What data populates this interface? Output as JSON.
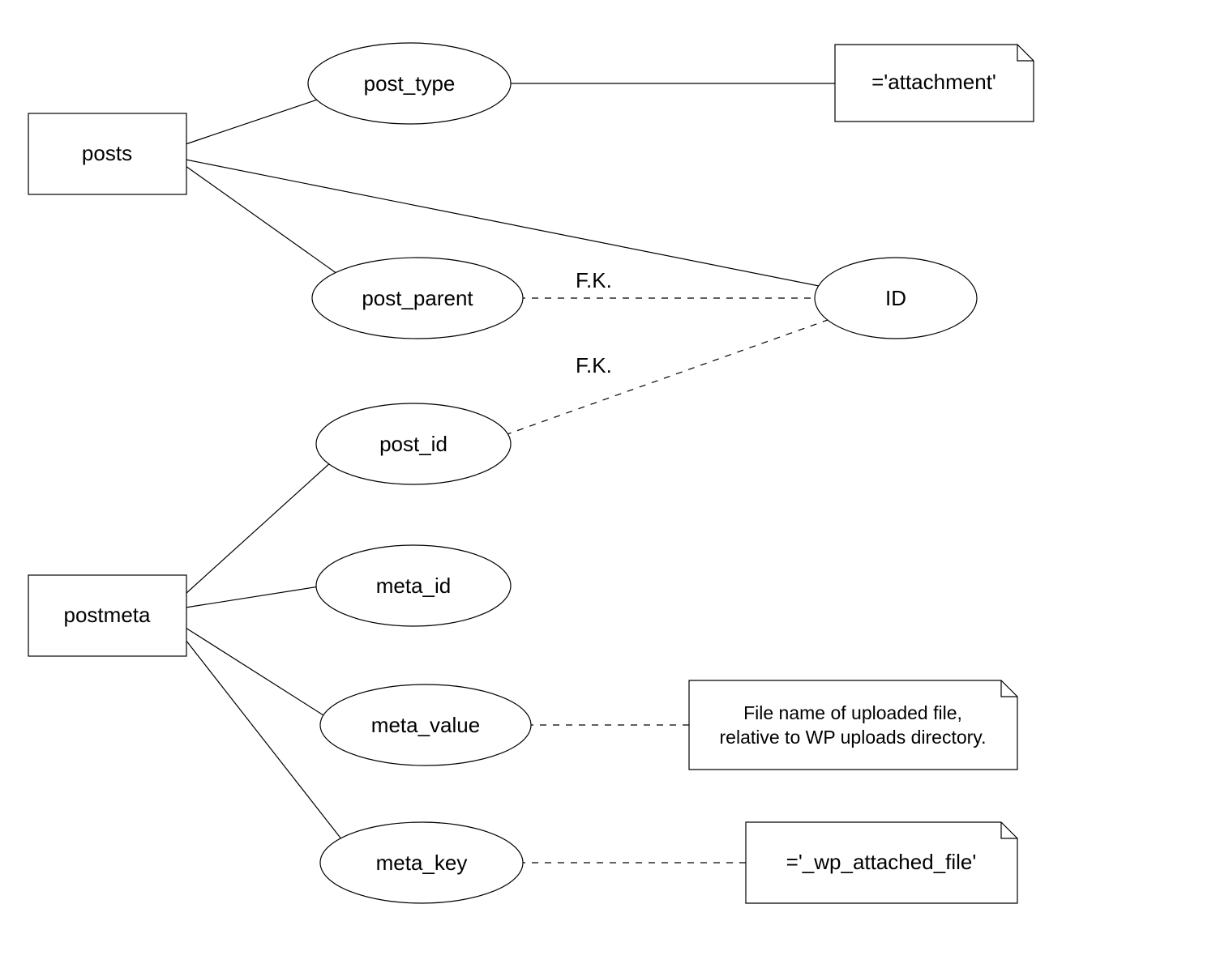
{
  "entities": {
    "posts": "posts",
    "postmeta": "postmeta"
  },
  "attributes": {
    "post_type": "post_type",
    "post_parent": "post_parent",
    "id": "ID",
    "post_id": "post_id",
    "meta_id": "meta_id",
    "meta_value": "meta_value",
    "meta_key": "meta_key"
  },
  "notes": {
    "attachment": "='attachment'",
    "meta_value_note_line1": "File name of uploaded file,",
    "meta_value_note_line2": "relative to WP uploads directory.",
    "meta_key_note": "='_wp_attached_file'"
  },
  "labels": {
    "fk": "F.K."
  }
}
